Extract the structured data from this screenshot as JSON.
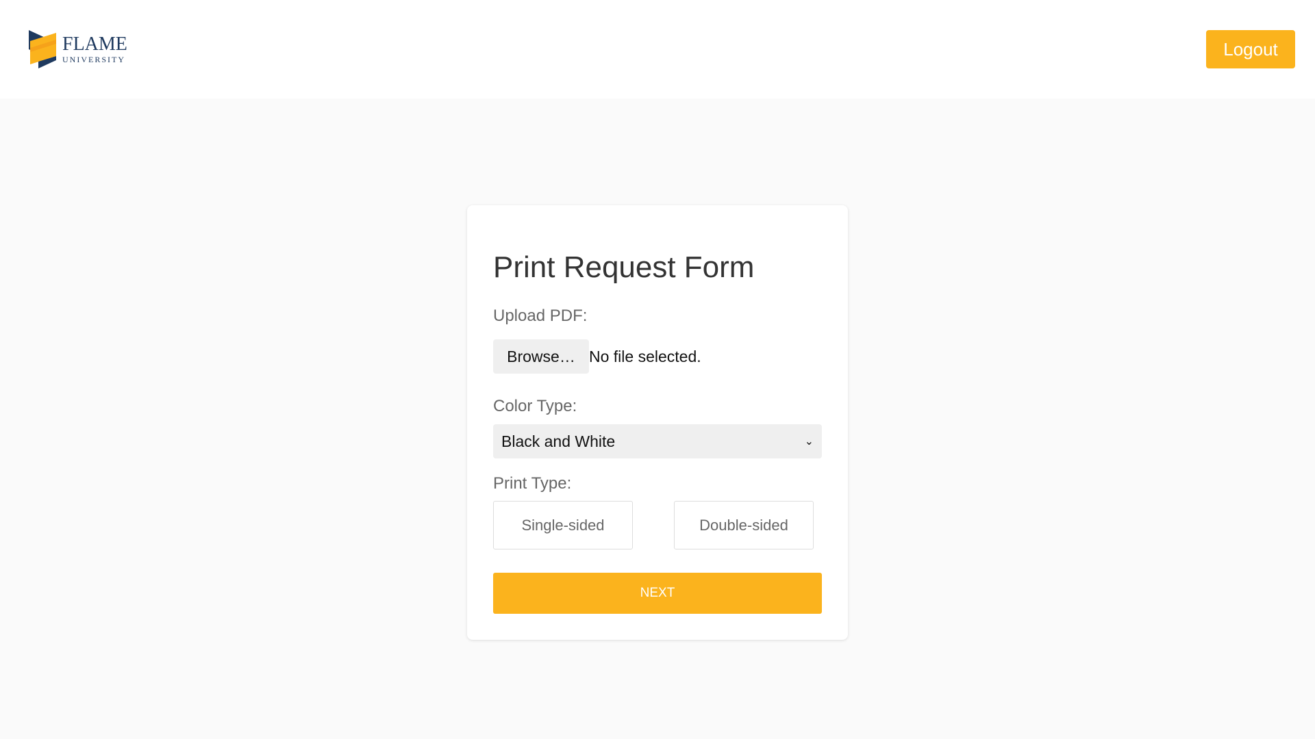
{
  "header": {
    "logo": {
      "name": "FLAME",
      "sub": "UNIVERSITY",
      "colors": {
        "navy": "#1f3a5f",
        "gold": "#fbb31d"
      }
    },
    "logout_label": "Logout"
  },
  "form": {
    "title": "Print Request Form",
    "upload_label": "Upload PDF:",
    "browse_label": "Browse…",
    "file_status": "No file selected.",
    "color_label": "Color Type:",
    "color_selected": "Black and White",
    "print_label": "Print Type:",
    "print_options": [
      "Single-sided",
      "Double-sided"
    ],
    "next_label": "NEXT"
  },
  "theme": {
    "accent": "#fbb31d",
    "background": "#fafafa",
    "card": "#ffffff"
  }
}
